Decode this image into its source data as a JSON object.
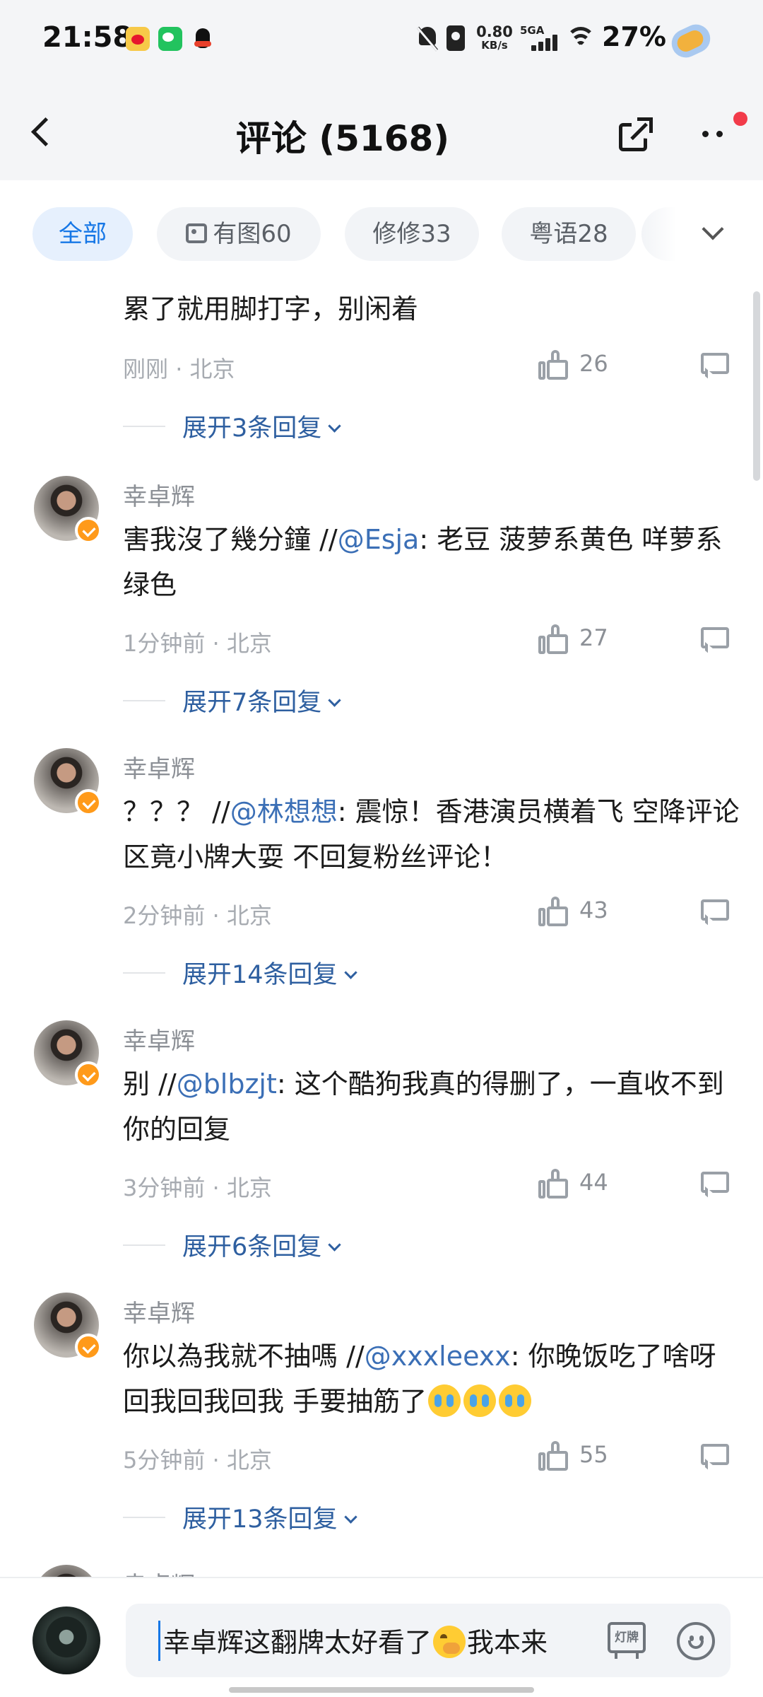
{
  "status_bar": {
    "time": "21:58",
    "net_speed": "0.80",
    "net_speed_unit": "KB/s",
    "network_type": "5GA",
    "battery": "27%",
    "notification_icons": [
      "weibo-icon",
      "wechat-icon",
      "qq-icon"
    ]
  },
  "header": {
    "title": "评论 (5168)"
  },
  "filters": [
    {
      "label": "全部",
      "active": true
    },
    {
      "label": "有图60",
      "active": false
    },
    {
      "label": "修修33",
      "active": false
    },
    {
      "label": "粤语28",
      "active": false
    }
  ],
  "comments": [
    {
      "name": "",
      "text": "累了就用脚打字，别闲着",
      "mention": "",
      "text_after": "",
      "time": "刚刚",
      "location": "北京",
      "likes": "26",
      "expand": "展开3条回复"
    },
    {
      "name": "幸卓辉",
      "text": "害我沒了幾分鐘 //",
      "mention": "@Esja",
      "text_after": ": 老豆 菠萝系黄色 咩萝系绿色",
      "time": "1分钟前",
      "location": "北京",
      "likes": "27",
      "expand": "展开7条回复"
    },
    {
      "name": "幸卓辉",
      "text": "？？？ //",
      "mention": "@林想想",
      "text_after": ": 震惊！香港演员横着飞 空降评论区竟小牌大耍 不回复粉丝评论！",
      "time": "2分钟前",
      "location": "北京",
      "likes": "43",
      "expand": "展开14条回复"
    },
    {
      "name": "幸卓辉",
      "text": "别 //",
      "mention": "@blbzjt",
      "text_after": ": 这个酷狗我真的得删了，一直收不到你的回复",
      "time": "3分钟前",
      "location": "北京",
      "likes": "44",
      "expand": "展开6条回复"
    },
    {
      "name": "幸卓辉",
      "text": "你以為我就不抽嗎 //",
      "mention": "@xxxleexx",
      "text_after": ": 你晚饭吃了啥呀 回我回我回我 手要抽筋了",
      "time": "5分钟前",
      "location": "北京",
      "likes": "55",
      "expand": "展开13条回复"
    },
    {
      "name": "幸卓辉"
    }
  ],
  "composer": {
    "draft_text": "幸卓辉这翻牌太好看了",
    "draft_text_after": "我本来",
    "lamp_label": "灯牌"
  },
  "colors": {
    "accent": "#1677e6",
    "mention": "#3b6fb6",
    "expand": "#2e5fa0",
    "badge": "#ff9a1a",
    "notify_dot": "#f23b4a"
  }
}
